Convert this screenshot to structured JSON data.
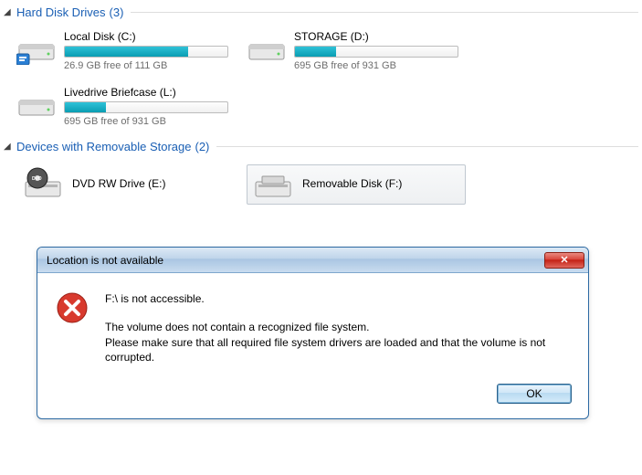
{
  "sections": {
    "hdd": {
      "title": "Hard Disk Drives",
      "count": "(3)"
    },
    "removable": {
      "title": "Devices with Removable Storage",
      "count": "(2)"
    }
  },
  "drives": {
    "c": {
      "label": "Local Disk (C:)",
      "stats": "26.9 GB free of 111 GB",
      "fill_pct": 76
    },
    "d": {
      "label": "STORAGE (D:)",
      "stats": "695 GB free of 931 GB",
      "fill_pct": 25
    },
    "l": {
      "label": "Livedrive Briefcase (L:)",
      "stats": "695 GB free of 931 GB",
      "fill_pct": 25
    },
    "e": {
      "label": "DVD RW Drive (E:)"
    },
    "f": {
      "label": "Removable Disk (F:)"
    }
  },
  "dialog": {
    "title": "Location is not available",
    "line1": "F:\\ is not accessible.",
    "line2": "The volume does not contain a recognized file system.",
    "line3": "Please make sure that all required file system drivers are loaded and that the volume is not corrupted.",
    "ok": "OK",
    "close_glyph": "✕"
  }
}
